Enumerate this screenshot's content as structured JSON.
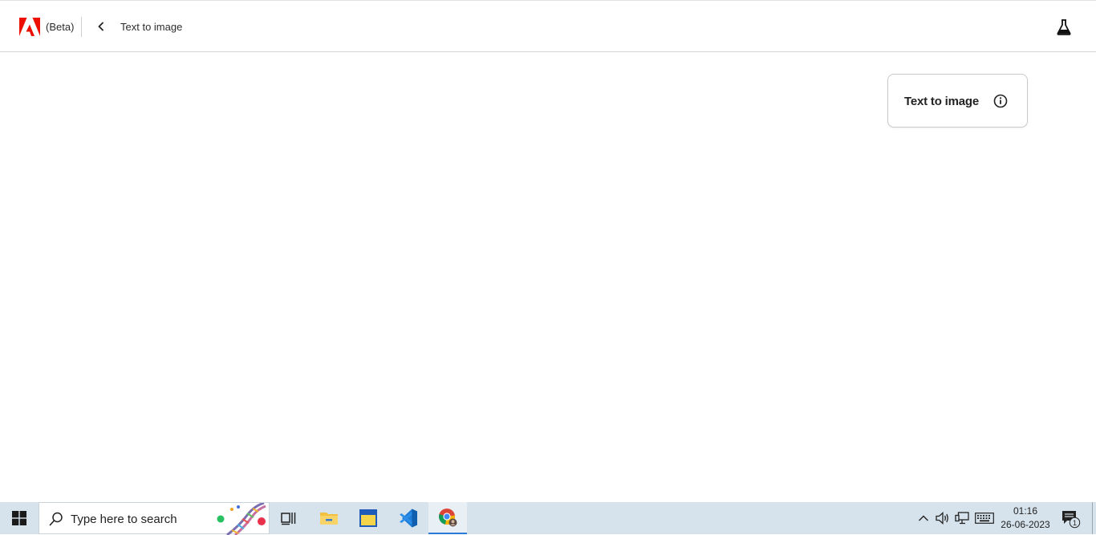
{
  "header": {
    "beta_label": "(Beta)",
    "breadcrumb": "Text to image",
    "brand_color": "#eb1000"
  },
  "card": {
    "title": "Text to image"
  },
  "taskbar": {
    "search_placeholder": "Type here to search",
    "time": "01:16",
    "date": "26-06-2023",
    "notification_count": "1"
  }
}
